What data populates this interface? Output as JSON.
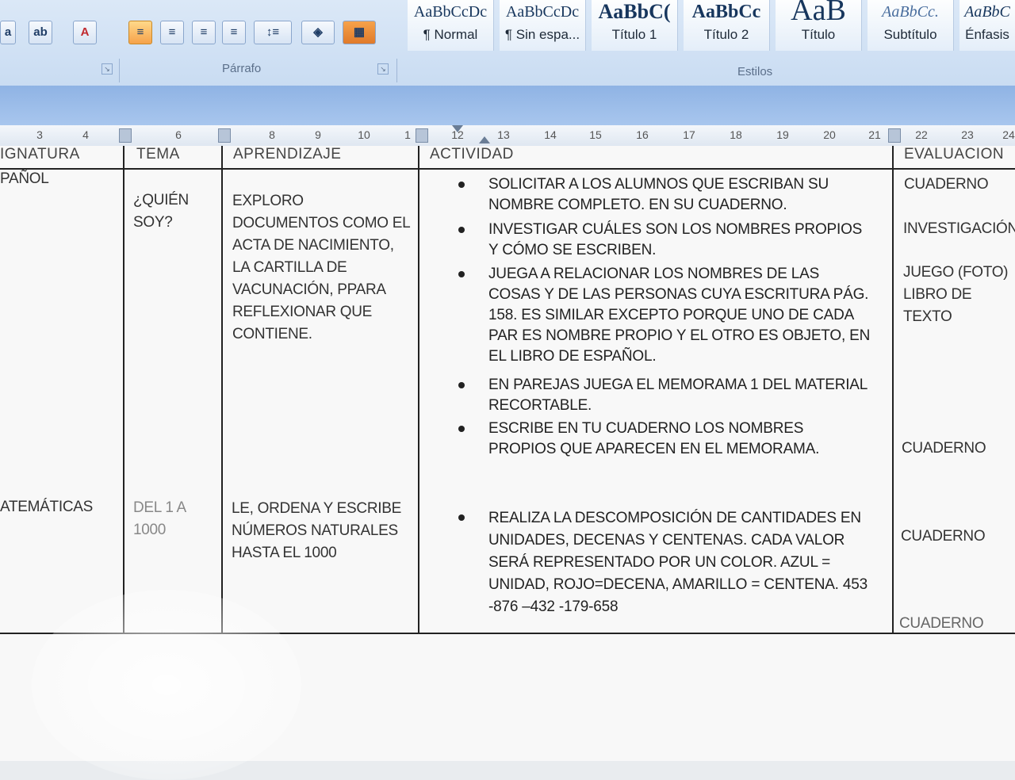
{
  "ribbon": {
    "paragraph_label": "Párrafo",
    "styles_label": "Estilos",
    "styles": [
      {
        "preview": "AaBbCcDc",
        "name": "¶ Normal"
      },
      {
        "preview": "AaBbCcDc",
        "name": "¶ Sin espa..."
      },
      {
        "preview": "AaBbC(",
        "name": "Título 1"
      },
      {
        "preview": "AaBbCc",
        "name": "Título 2"
      },
      {
        "preview": "AaB",
        "name": "Título"
      },
      {
        "preview": "AaBbCc.",
        "name": "Subtítulo"
      },
      {
        "preview": "AaBbC",
        "name": "Énfasis"
      }
    ]
  },
  "ruler": {
    "ticks": [
      "3",
      "4",
      "6",
      "8",
      "9",
      "10",
      "1",
      "12",
      "13",
      "14",
      "15",
      "16",
      "17",
      "18",
      "19",
      "20",
      "21",
      "22",
      "23",
      "24"
    ]
  },
  "table": {
    "headers": {
      "asignatura": "IGNATURA",
      "tema": "TEMA",
      "aprendizaje": "APRENDIZAJE",
      "actividad": "ACTIVIDAD",
      "evaluacion": "EVALUACION"
    },
    "rows": [
      {
        "asignatura": "PAÑOL",
        "tema": "¿QUIÉN SOY?",
        "aprendizaje": "EXPLORO DOCUMENTOS COMO EL ACTA DE NACIMIENTO, LA CARTILLA DE VACUNACIÓN, PPARA REFLEXIONAR QUE CONTIENE.",
        "actividades": [
          "SOLICITAR A LOS ALUMNOS QUE ESCRIBAN SU NOMBRE COMPLETO. EN SU CUADERNO.",
          "INVESTIGAR CUÁLES SON LOS NOMBRES PROPIOS Y CÓMO SE ESCRIBEN.",
          "JUEGA A RELACIONAR LOS NOMBRES DE LAS COSAS Y DE LAS PERSONAS CUYA ESCRITURA PÁG. 158. ES SIMILAR EXCEPTO PORQUE UNO DE CADA PAR ES NOMBRE PROPIO Y EL OTRO ES OBJETO, EN EL LIBRO DE ESPAÑOL.",
          "EN PAREJAS JUEGA EL MEMORAMA 1 DEL MATERIAL RECORTABLE.",
          "ESCRIBE EN TU CUADERNO LOS NOMBRES PROPIOS QUE APARECEN EN EL MEMORAMA."
        ],
        "evaluaciones": [
          "CUADERNO",
          "INVESTIGACIÓN",
          "JUEGO (FOTO)",
          "LIBRO DE TEXTO",
          "CUADERNO"
        ]
      },
      {
        "asignatura": "ATEMÁTICAS",
        "tema": "DEL 1 A 1000",
        "aprendizaje": "LE, ORDENA Y ESCRIBE NÚMEROS NATURALES HASTA EL 1000",
        "actividades": [
          "REALIZA LA DESCOMPOSICIÓN DE CANTIDADES EN UNIDADES, DECENAS Y CENTENAS. CADA VALOR SERÁ REPRESENTADO POR UN COLOR. AZUL = UNIDAD, ROJO=DECENA, AMARILLO = CENTENA. 453 -876 –432 -179-658"
        ],
        "evaluaciones": [
          "CUADERNO",
          "CUADERNO"
        ]
      }
    ]
  },
  "colors": {
    "ribbon_bg": "#cfdff3",
    "band": "#9dbde9",
    "table_border": "#222222",
    "text": "#333333"
  }
}
